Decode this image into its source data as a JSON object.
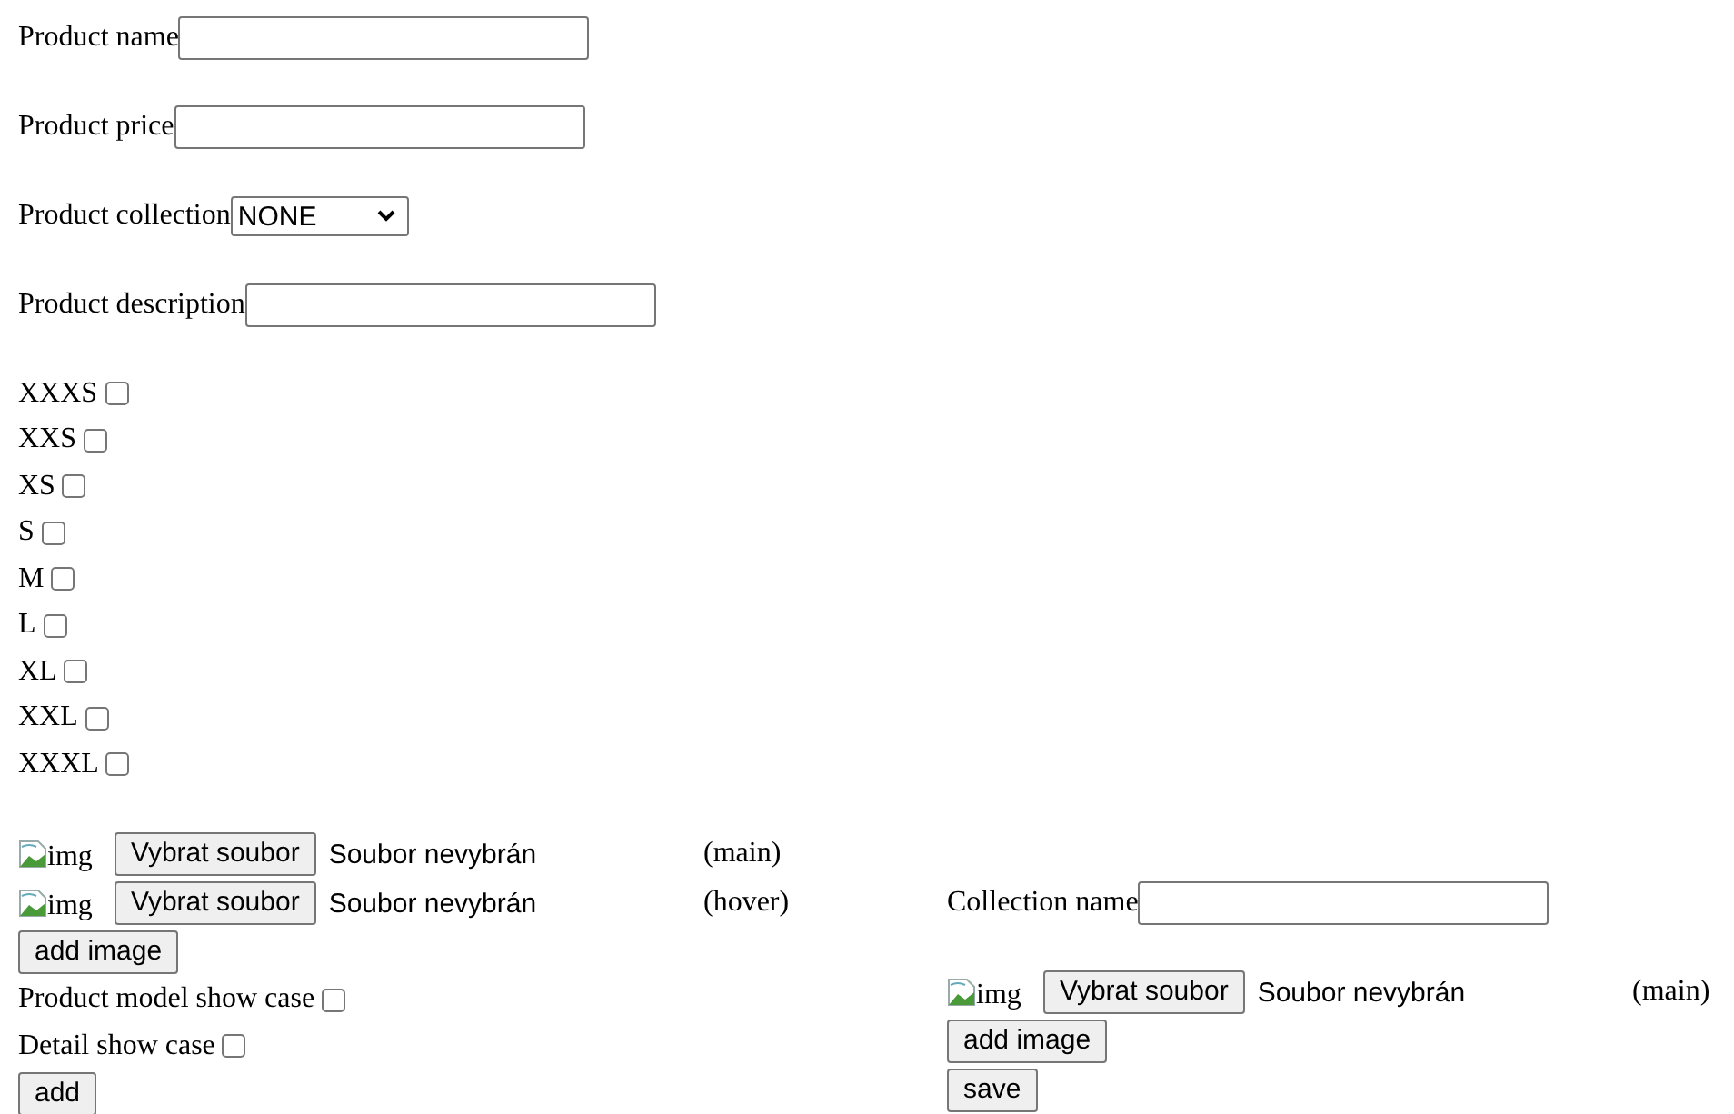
{
  "product_form": {
    "fields": [
      {
        "kind": "text",
        "label": "Product name"
      },
      {
        "kind": "text",
        "label": "Product price"
      },
      {
        "kind": "select",
        "label": "Product collection",
        "value": "NONE"
      },
      {
        "kind": "text",
        "label": "Product description"
      }
    ],
    "sizes": [
      {
        "label": "XXXS",
        "checked": false
      },
      {
        "label": "XXS",
        "checked": false
      },
      {
        "label": "XS",
        "checked": false
      },
      {
        "label": "S",
        "checked": false
      },
      {
        "label": "M",
        "checked": false
      },
      {
        "label": "L",
        "checked": false
      },
      {
        "label": "XL",
        "checked": false
      },
      {
        "label": "XXL",
        "checked": false
      },
      {
        "label": "XXXL",
        "checked": false
      }
    ],
    "images": [
      {
        "alt": "img",
        "button": "Vybrat soubor",
        "status": "Soubor nevybrán",
        "role": "(main)"
      },
      {
        "alt": "img",
        "button": "Vybrat soubor",
        "status": "Soubor nevybrán",
        "role": "(hover)"
      }
    ],
    "add_image_button": "add image",
    "showcases": [
      {
        "label": "Product model show case",
        "checked": false
      },
      {
        "label": "Detail show case",
        "checked": false
      }
    ],
    "add_button": "add"
  },
  "collection_form": {
    "fields": [
      {
        "kind": "text",
        "label": "Collection name"
      }
    ],
    "images": [
      {
        "alt": "img",
        "button": "Vybrat soubor",
        "status": "Soubor nevybrán",
        "role": "(main)"
      }
    ],
    "add_image_button": "add image",
    "save_button": "save"
  }
}
